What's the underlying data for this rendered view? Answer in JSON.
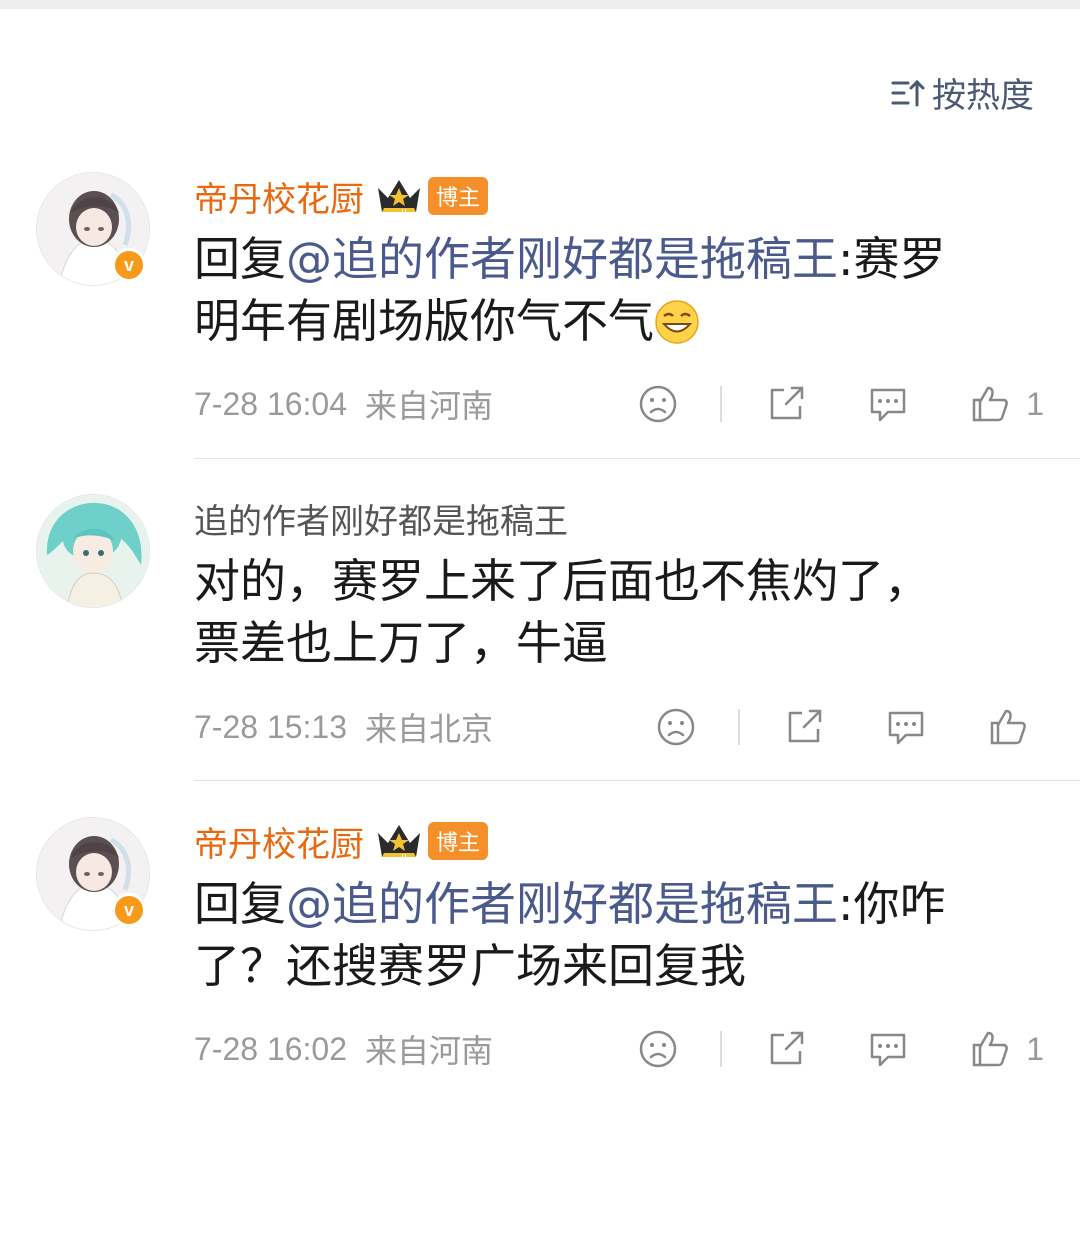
{
  "sort": {
    "label": "按热度"
  },
  "comments": [
    {
      "author": "帝丹校花厨",
      "badge": "博主",
      "verified": "v",
      "reply_prefix": "回复",
      "mention": "@追的作者刚好都是拖稿王",
      "text_line1_rest": ":赛罗",
      "text_line2": "明年有剧场版你气不气",
      "time": "7-28 16:04",
      "location": "来自河南",
      "likes": "1"
    },
    {
      "author": "追的作者刚好都是拖稿王",
      "text_line1": "对的，赛罗上来了后面也不焦灼了，",
      "text_line2": "票差也上万了，牛逼",
      "time": "7-28 15:13",
      "location": "来自北京",
      "likes": ""
    },
    {
      "author": "帝丹校花厨",
      "badge": "博主",
      "verified": "v",
      "reply_prefix": "回复",
      "mention": "@追的作者刚好都是拖稿王",
      "text_line1_rest": ":你咋",
      "text_line2": "了？还搜赛罗广场来回复我",
      "time": "7-28 16:02",
      "location": "来自河南",
      "likes": "1"
    }
  ]
}
